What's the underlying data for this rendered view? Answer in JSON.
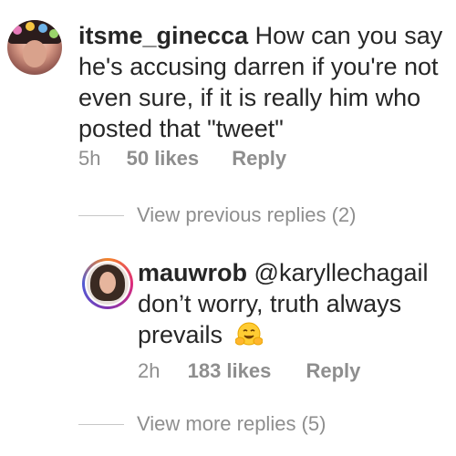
{
  "comments": [
    {
      "username": "itsme_ginecca",
      "text": "How can you say he's accusing darren if you're not even sure, if it is really him who posted that \"tweet\"",
      "time": "5h",
      "likes": "50 likes",
      "reply": "Reply",
      "avatar_icon": "profile-photo"
    },
    {
      "username": "mauwrob",
      "mention": "@karyllechagail",
      "text": "don’t worry, truth always prevails",
      "emoji": "hugging-face-emoji",
      "time": "2h",
      "likes": "183 likes",
      "reply": "Reply",
      "avatar_icon": "profile-photo-story-ring"
    }
  ],
  "view_previous": "View previous replies (2)",
  "view_more": "View more replies (5)",
  "colors": {
    "text": "#262626",
    "meta": "#8e8e8e",
    "story_ring": [
      "#f58529",
      "#dd2a7b",
      "#8134af",
      "#515bd4"
    ]
  }
}
